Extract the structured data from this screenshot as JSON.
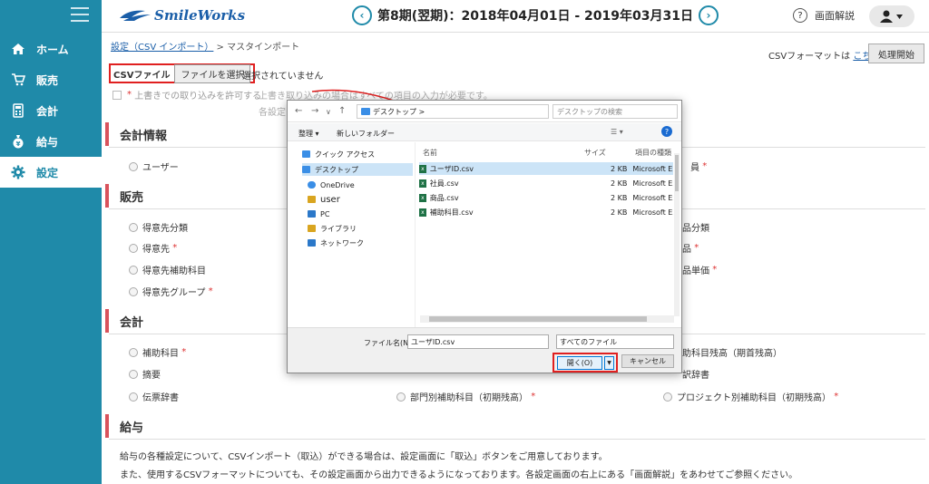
{
  "sidebar": {
    "items": [
      {
        "label": "ホーム",
        "icon": "home-icon"
      },
      {
        "label": "販売",
        "icon": "cart-icon"
      },
      {
        "label": "会計",
        "icon": "calculator-icon"
      },
      {
        "label": "給与",
        "icon": "money-bag-icon"
      },
      {
        "label": "設定",
        "icon": "gear-icon"
      }
    ]
  },
  "header": {
    "logo": "SmileWorks",
    "period": "第8期(翌期)：2018年04月01日 - 2019年03月31日",
    "prev": "‹",
    "next": "›",
    "help_label": "画面解説",
    "help_icon": "?"
  },
  "main": {
    "breadcrumb_link": "設定（CSV インポート）",
    "breadcrumb_sep": ">",
    "breadcrumb_current": "マスタインポート",
    "format_label": "CSVフォーマットは",
    "format_link": "こちら",
    "run_button": "処理開始",
    "csv_label": "CSVファイル",
    "file_button": "ファイルを選択",
    "no_file": "選択されていません",
    "overwrite_label": "上書きでの取り込みを許可する",
    "note1": "上書き取り込みの場合はすべての項目の入力が必要です。",
    "note2": "各設定",
    "sections": [
      {
        "title": "会計情報"
      },
      {
        "title": "販売"
      },
      {
        "title": "会計"
      },
      {
        "title": "給与"
      }
    ],
    "company_options": {
      "left": "ユーザー",
      "right": "員"
    },
    "sales_options": {
      "left": [
        "得意先分類",
        "得意先",
        "得意先補助科目",
        "得意先グループ"
      ],
      "right": [
        "品分類",
        "品",
        "品単価"
      ]
    },
    "accounting_options": {
      "left": [
        "補助科目",
        "摘要",
        "伝票辞書"
      ],
      "mid": [
        "部門別補助科目（初期残高）"
      ],
      "right": [
        "助科目残高（期首残高）",
        "訳辞書",
        "プロジェクト別補助科目（初期残高）"
      ]
    },
    "payroll_text1": "給与の各種設定について、CSVインポート（取込）ができる場合は、設定画面に「取込」ボタンをご用意しております。",
    "payroll_text2": "また、使用するCSVフォーマットについても、その設定画面から出力できるようになっております。各設定画面の右上にある「画面解説」をあわせてご参照ください。",
    "required_mark": "*"
  },
  "dialog": {
    "path": "デスクトップ",
    "path_sep": ">",
    "search_placeholder": "デスクトップの検索",
    "organize": "整理 ▾",
    "new_folder": "新しいフォルダー",
    "tree": [
      "クイック アクセス",
      "デスクトップ",
      "OneDrive",
      "user",
      "PC",
      "ライブラリ",
      "ネットワーク"
    ],
    "col_name": "名前",
    "col_size": "サイズ",
    "col_type": "項目の種類",
    "files": [
      {
        "name": "ユーザID.csv",
        "size": "2 KB",
        "type": "Microsoft Ex"
      },
      {
        "name": "社員.csv",
        "size": "2 KB",
        "type": "Microsoft Ex"
      },
      {
        "name": "商品.csv",
        "size": "2 KB",
        "type": "Microsoft Ex"
      },
      {
        "name": "補助科目.csv",
        "size": "2 KB",
        "type": "Microsoft Ex"
      }
    ],
    "filename_label": "ファイル名(N):",
    "filename_value": "ユーザID.csv",
    "filetype": "すべてのファイル",
    "open_button": "開く(O)",
    "cancel_button": "キャンセル"
  }
}
